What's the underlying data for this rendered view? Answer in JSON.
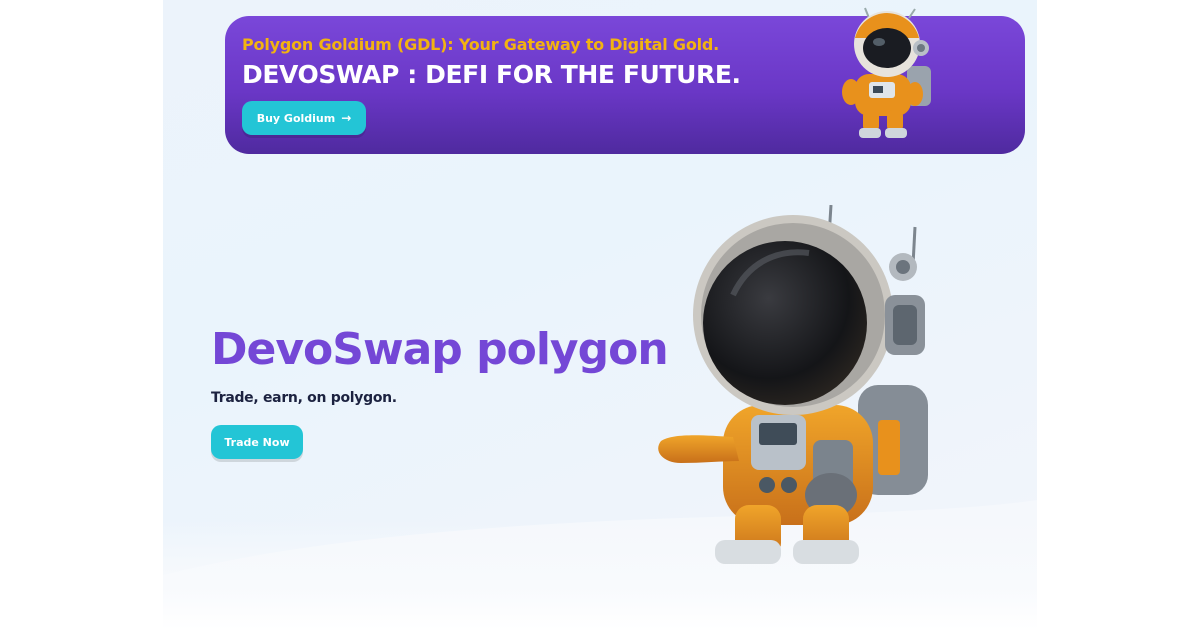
{
  "banner": {
    "subtitle": "Polygon Goldium (GDL): Your Gateway to Digital Gold.",
    "title": "DEVOSWAP : DEFI FOR THE FUTURE.",
    "button_label": "Buy Goldium",
    "button_icon": "arrow-right-icon"
  },
  "hero": {
    "title": "DevoSwap polygon",
    "subtitle": "Trade, earn, on polygon.",
    "button_label": "Trade Now"
  },
  "colors": {
    "banner_bg": "#7447d6",
    "accent_gold": "#f2b311",
    "button_cyan": "#23c5d6",
    "hero_title": "#7447d6",
    "suit_orange": "#e8911c"
  }
}
